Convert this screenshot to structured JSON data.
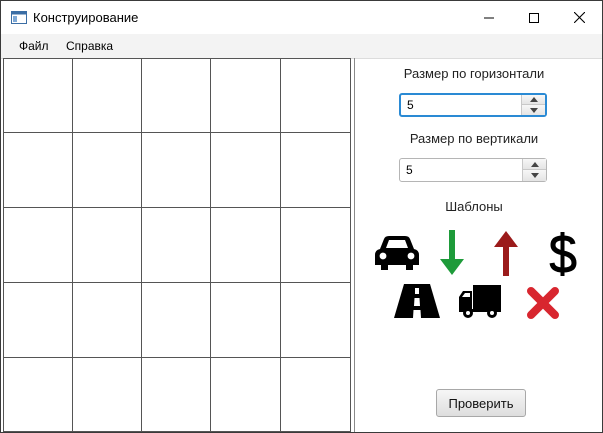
{
  "window": {
    "title": "Конструирование"
  },
  "menu": {
    "items": [
      "Файл",
      "Справка"
    ]
  },
  "grid": {
    "columns": 5,
    "rows": 5
  },
  "panel": {
    "horizontal_label": "Размер по горизонтали",
    "horizontal_value": "5",
    "vertical_label": "Размер по вертикали",
    "vertical_value": "5",
    "templates_label": "Шаблоны",
    "templates": [
      "car-icon",
      "arrow-down-icon",
      "arrow-up-icon",
      "dollar-icon",
      "road-icon",
      "truck-icon",
      "delete-x-icon"
    ],
    "check_button": "Проверить"
  },
  "colors": {
    "arrow_down": "#1e9b3a",
    "arrow_up": "#9b1b1b",
    "delete": "#d8262f",
    "focus": "#2a8ad4"
  }
}
